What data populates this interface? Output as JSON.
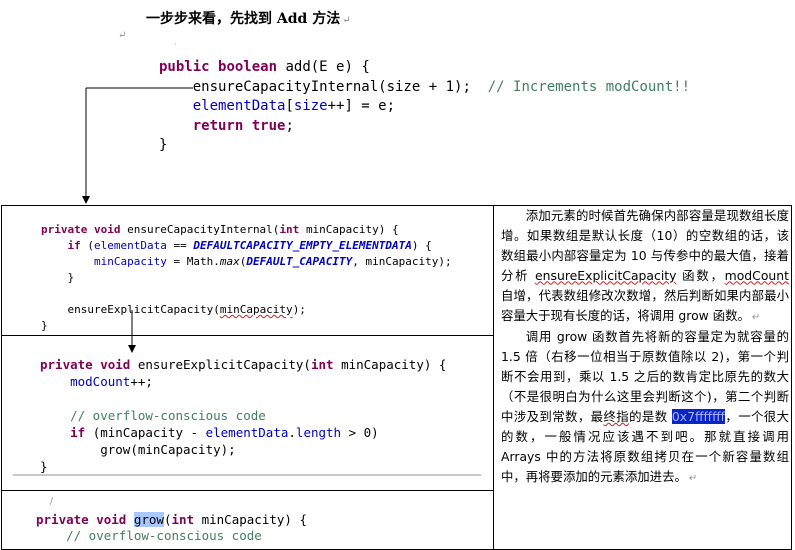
{
  "heading": {
    "text": "一步步来看，先找到 Add 方法",
    "mark": "↵"
  },
  "code1": {
    "l1": [
      "public",
      "boolean",
      "add(E e) {"
    ],
    "l2": [
      "ensureCapacityInternal(size + 1);",
      "// Increments modCount!!"
    ],
    "l3": [
      "elementData",
      "[",
      "size",
      "++] = e;"
    ],
    "l4": [
      "return",
      "true",
      ";"
    ],
    "l5": "}"
  },
  "code2": {
    "l1": [
      "private",
      "void",
      "ensureCapacityInternal(",
      "int",
      "minCapacity) {"
    ],
    "l2": [
      "if",
      "(",
      "elementData",
      " == ",
      "DEFAULTCAPACITY_EMPTY_ELEMENTDATA",
      ") {"
    ],
    "l3": [
      "minCapacity",
      " = Math.",
      "max",
      "(",
      "DEFAULT_CAPACITY",
      ", minCapacity);"
    ],
    "l4": "}",
    "l5": [
      "ensureExplicitCapacity(",
      "minCapacity",
      ");"
    ],
    "l6": "}"
  },
  "code3": {
    "l1": [
      "private",
      "void",
      "ensureExplicitCapacity(",
      "int",
      "minCapacity) {"
    ],
    "l2": [
      "modCount",
      "++;"
    ],
    "l3": "// overflow-conscious code",
    "l4": [
      "if",
      "(minCapacity - ",
      "elementData",
      ".",
      "length",
      " > 0)"
    ],
    "l5": "grow(minCapacity);",
    "l6": "}"
  },
  "code4": {
    "l1": [
      "private",
      "void",
      "grow",
      "(",
      "int",
      "minCapacity) {"
    ],
    "l2": "// overflow-conscious code"
  },
  "explanation": {
    "p1": [
      "添加元素的时候首先确保内部容量是现数组长度增",
      "。如果数组是默认长度（10）的空数组的话，该数组最小内部容量定为 10 与传参中的最大值，接着分析 ",
      "ensureExplicitCapacity",
      " 函数，",
      "modCount",
      " 自增，代表数组修改次数增",
      "，然后判断如果内部最小容量大于现有长度的话，将调用 grow 函数。",
      "↵"
    ],
    "p2": [
      "调用 grow 函数首先将新的容量定为就容量的 1.5 倍（右移一位相当于原数值除以 2)，第一个判断不会用到，乘以 1.5 之后的数肯定比原先的数大（不是很明白为什么这里会判断这个)，第二个判断中涉及到常数，最",
      "终指",
      "的是数 ",
      "0x7fffffff",
      "，一个很大的数，一般情况应该遇不到吧。那就直接调用 Arrays 中的方法将原数组拷贝在一个新容量数组中，再将要添加的元素添加进去。",
      "↵"
    ]
  }
}
